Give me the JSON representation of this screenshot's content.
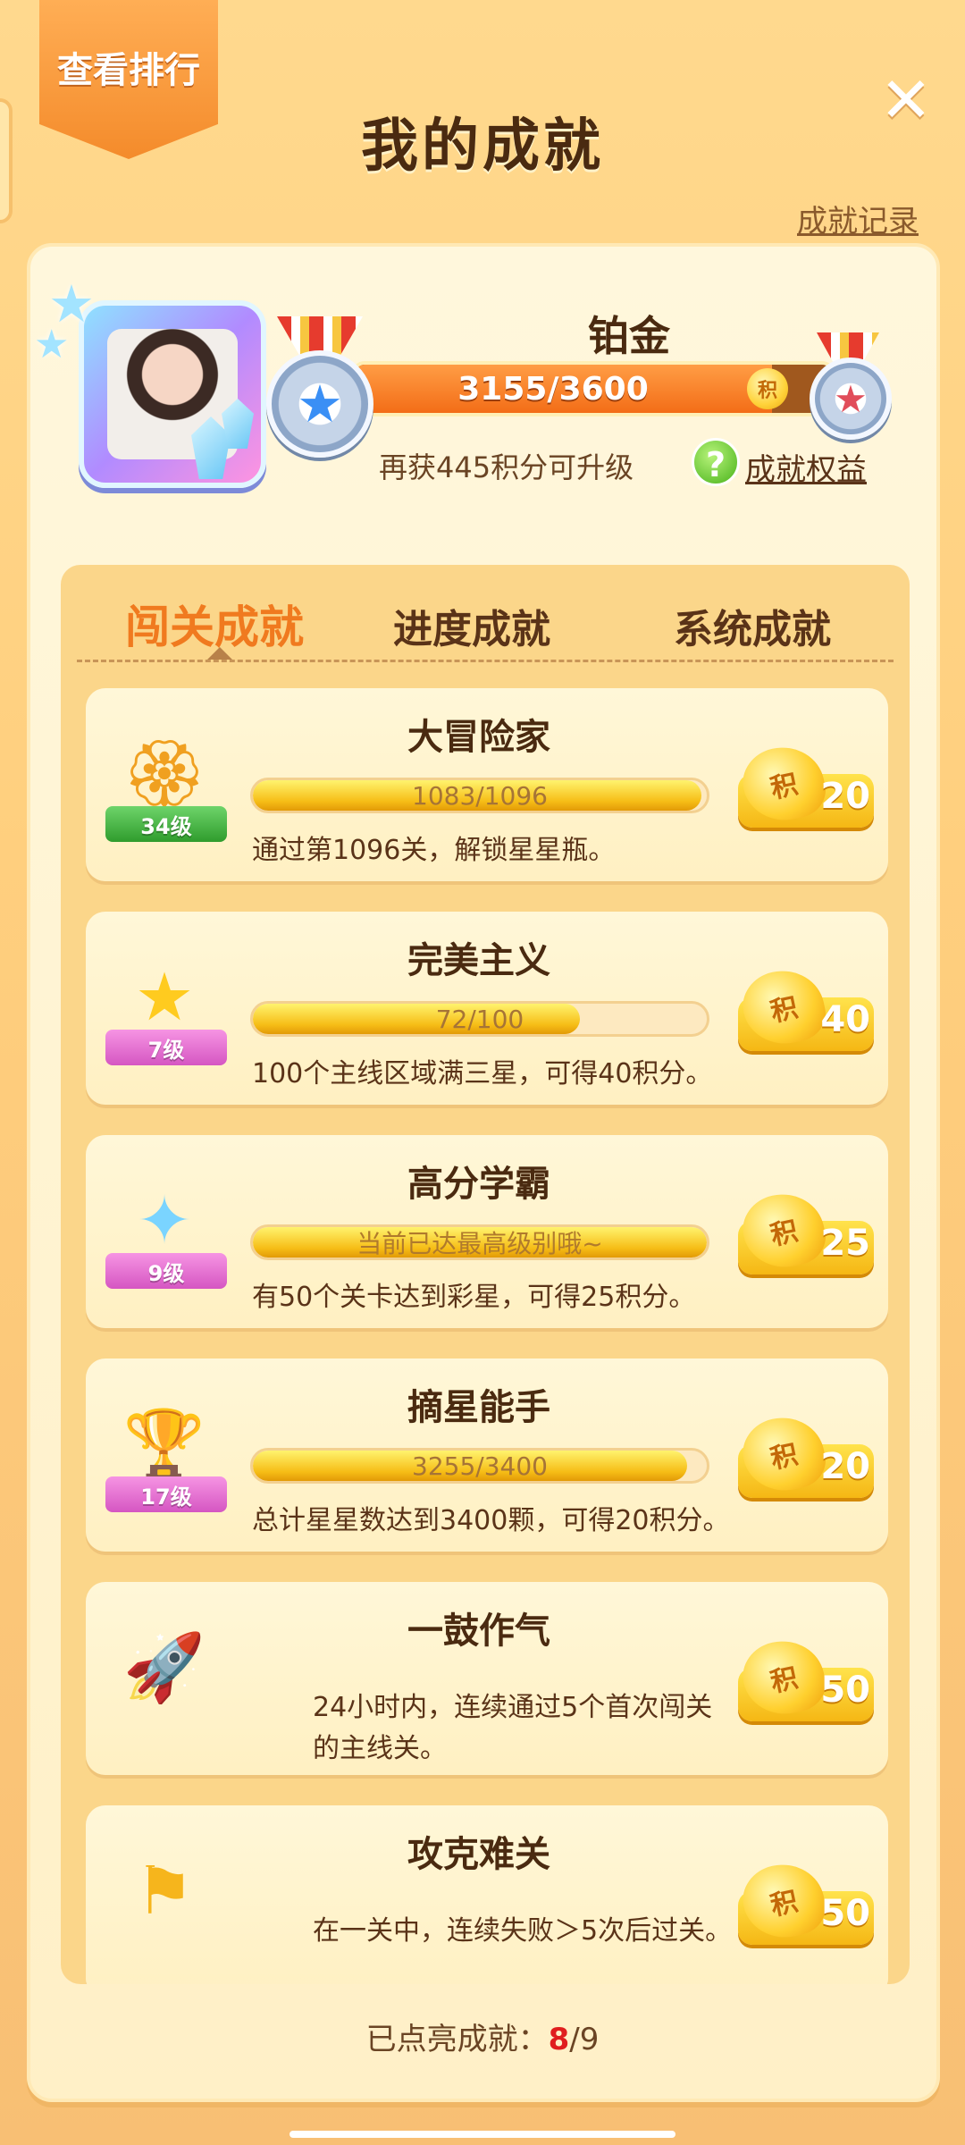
{
  "header": {
    "rank_button": "查看排行",
    "title": "我的成就",
    "records_link": "成就记录"
  },
  "profile": {
    "tier_name": "铂金",
    "progress_text": "3155/3600",
    "progress_ratio": 0.876,
    "points_unit": "积",
    "upgrade_hint": "再获445积分可升级",
    "benefits_link": "成就权益"
  },
  "tabs": [
    {
      "label": "闯关成就",
      "active": true
    },
    {
      "label": "进度成就",
      "active": false
    },
    {
      "label": "系统成就",
      "active": false
    }
  ],
  "achievements": [
    {
      "title": "大冒险家",
      "level": "34级",
      "progress_text": "1083/1096",
      "progress_ratio": 0.988,
      "points": "20",
      "desc": "通过第1096关，解锁星星瓶。"
    },
    {
      "title": "完美主义",
      "level": "7级",
      "progress_text": "72/100",
      "progress_ratio": 0.72,
      "points": "40",
      "desc": "100个主线区域满三星，可得40积分。"
    },
    {
      "title": "高分学霸",
      "level": "9级",
      "progress_text": "当前已达最高级别哦~",
      "progress_ratio": 1.0,
      "points": "25",
      "desc": "有50个关卡达到彩星，可得25积分。"
    },
    {
      "title": "摘星能手",
      "level": "17级",
      "progress_text": "3255/3400",
      "progress_ratio": 0.957,
      "points": "20",
      "desc": "总计星星数达到3400颗，可得20积分。"
    },
    {
      "title": "一鼓作气",
      "points": "50",
      "desc": "24小时内，连续通过5个首次闯关的主线关。"
    },
    {
      "title": "攻克难关",
      "points": "50",
      "desc": "在一关中，连续失败＞5次后过关。"
    }
  ],
  "footer": {
    "label": "已点亮成就：",
    "lit": "8",
    "total": "/9"
  },
  "colors": {
    "accent": "#f07a1f",
    "background": "#ffd98e",
    "count_highlight": "#e01e1e"
  }
}
